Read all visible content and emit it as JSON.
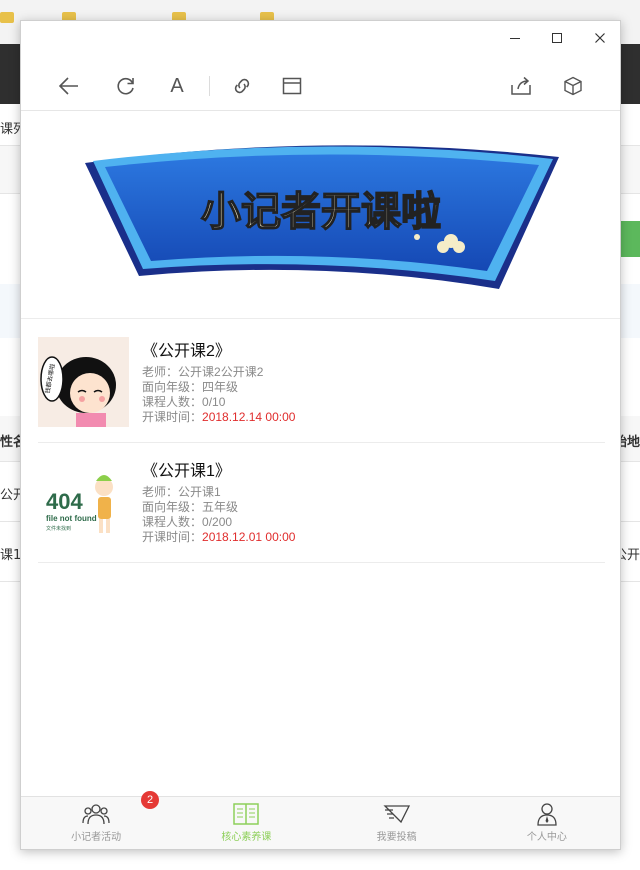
{
  "background": {
    "fragments": {
      "tab_fragment": "课列",
      "column_fragment_left": "性名",
      "column_fragment_right": "始地",
      "row1_fragment": "公开",
      "row2_fragment": "课1",
      "row2_fragment_right": "公开"
    }
  },
  "window": {
    "minimize_symbol": "—",
    "maximize_symbol": "□",
    "close_symbol": "✕"
  },
  "toolbar": {
    "font_label": "A"
  },
  "banner": {
    "text": "小记者开课啦"
  },
  "courses": [
    {
      "title": "《公开课2》",
      "teacher_label": "老师：",
      "teacher": "公开课2公开课2",
      "grade_label": "面向年级：",
      "grade": "四年级",
      "count_label": "课程人数：",
      "count": "0/10",
      "time_label": "开课时间：",
      "time": "2018.12.14 00:00",
      "thumb_text": "钱都去哪啦"
    },
    {
      "title": "《公开课1》",
      "teacher_label": "老师：",
      "teacher": "公开课1",
      "grade_label": "面向年级：",
      "grade": "五年级",
      "count_label": "课程人数：",
      "count": "0/200",
      "time_label": "开课时间：",
      "time": "2018.12.01 00:00",
      "thumb_big": "404",
      "thumb_sub": "file not found",
      "thumb_small": "文件未找到"
    }
  ],
  "tabbar": {
    "tabs": [
      {
        "label": "小记者活动",
        "icon": "people-icon",
        "badge": "2"
      },
      {
        "label": "核心素养课",
        "icon": "book-icon"
      },
      {
        "label": "我要投稿",
        "icon": "submit-icon"
      },
      {
        "label": "个人中心",
        "icon": "user-icon"
      }
    ]
  },
  "colors": {
    "accent_green": "#8ed05a",
    "time_red": "#e02d2d",
    "badge_red": "#e53935",
    "banner_blue": "#1a55c8"
  }
}
